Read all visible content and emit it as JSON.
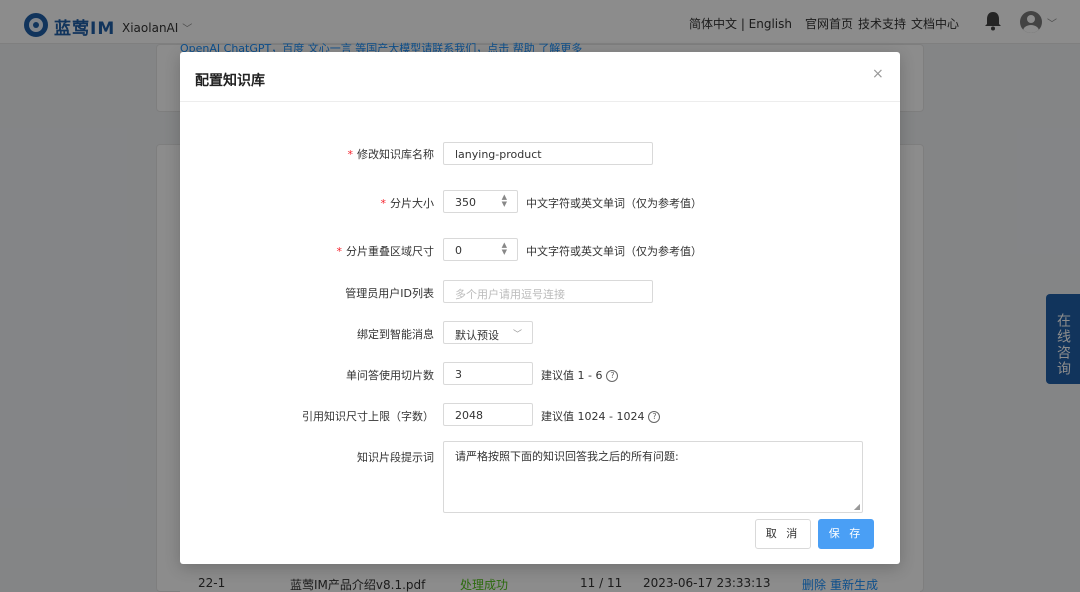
{
  "header": {
    "brand": "蓝莺IM",
    "app_name": "XiaolanAI",
    "language": "简体中文 | English",
    "nav": [
      "官网首页",
      "技术支持",
      "文档中心"
    ]
  },
  "background": {
    "partial_text": "OpenAI ChatGPT，百度 文心一言 等国产大模型请联系我们，点击 帮助 了解更多",
    "table_row": {
      "id": "22-1",
      "file": "蓝莺IM产品介绍v8.1.pdf",
      "status": "处理成功",
      "progress": "11 / 11",
      "time": "2023-06-17 23:33:13",
      "action_delete": "删除",
      "action_regenerate": "重新生成"
    },
    "side_button": "在线咨询"
  },
  "modal": {
    "title": "配置知识库",
    "close": "×",
    "fields": {
      "name": {
        "label": "修改知识库名称",
        "value": "lanying-product"
      },
      "chunk_size": {
        "label": "分片大小",
        "value": "350",
        "hint": "中文字符或英文单词（仅为参考值）"
      },
      "overlap": {
        "label": "分片重叠区域尺寸",
        "value": "0",
        "hint": "中文字符或英文单词（仅为参考值）"
      },
      "admin_ids": {
        "label": "管理员用户ID列表",
        "placeholder": "多个用户请用逗号连接"
      },
      "bind": {
        "label": "绑定到智能消息",
        "value": "默认预设"
      },
      "chunks_per_q": {
        "label": "单问答使用切片数",
        "value": "3",
        "hint": "建议值 1 - 6"
      },
      "ref_limit": {
        "label": "引用知识尺寸上限（字数）",
        "value": "2048",
        "hint": "建议值 1024 - 1024"
      },
      "prompt": {
        "label": "知识片段提示词",
        "value": "请严格按照下面的知识回答我之后的所有问题:"
      }
    },
    "cancel_label": "取 消",
    "save_label": "保 存"
  }
}
